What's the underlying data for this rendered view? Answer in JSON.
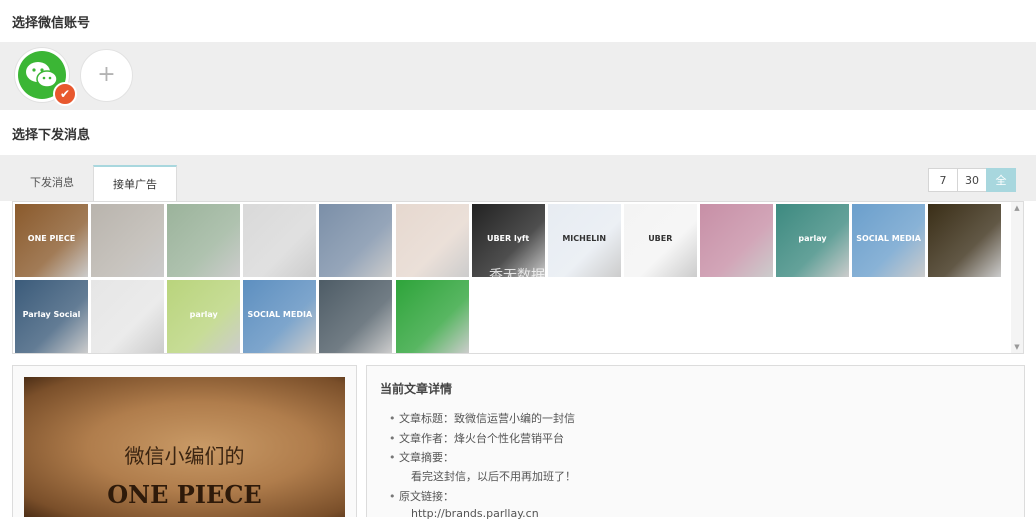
{
  "sections": {
    "account_title": "选择微信账号",
    "message_title": "选择下发消息"
  },
  "account": {
    "add_label": "+",
    "check_glyph": "✔",
    "wechat_icon": "wechat-icon"
  },
  "tabs": [
    {
      "label": "下发消息",
      "active": false
    },
    {
      "label": "接单广告",
      "active": true
    }
  ],
  "range_buttons": [
    {
      "label": "7",
      "active": false
    },
    {
      "label": "30",
      "active": false
    },
    {
      "label": "全",
      "active": true
    }
  ],
  "watermark": "香无数据",
  "thumbnails": [
    {
      "name": "thumb-one-piece",
      "color": "#8a5a2c",
      "text": "ONE PIECE"
    },
    {
      "name": "thumb-meeting-room",
      "color": "#b9b4ad",
      "text": ""
    },
    {
      "name": "thumb-speech-bubbles",
      "color": "#9bb39b",
      "text": ""
    },
    {
      "name": "thumb-smartphones",
      "color": "#d9d9d9",
      "text": ""
    },
    {
      "name": "thumb-businessmen",
      "color": "#7b8fa8",
      "text": ""
    },
    {
      "name": "thumb-hands",
      "color": "#e6d8cf",
      "text": ""
    },
    {
      "name": "thumb-uber-lyft",
      "color": "#222222",
      "text": "UBER lyft"
    },
    {
      "name": "thumb-michelin",
      "color": "#e7ecf2",
      "text": "MICHELIN"
    },
    {
      "name": "thumb-uber-logo",
      "color": "#f4f4f4",
      "text": "UBER"
    },
    {
      "name": "thumb-weibo-monsters",
      "color": "#c78fa6",
      "text": ""
    },
    {
      "name": "thumb-world-map",
      "color": "#3d8a80",
      "text": "parlay"
    },
    {
      "name": "thumb-social-media-globe",
      "color": "#6b9fcc",
      "text": "SOCIAL MEDIA"
    },
    {
      "name": "thumb-city-lights",
      "color": "#3a2e17",
      "text": ""
    },
    {
      "name": "thumb-parlay-site",
      "color": "#3b5b7a",
      "text": "Parlay Social"
    },
    {
      "name": "thumb-red-figure",
      "color": "#e6e6e6",
      "text": ""
    },
    {
      "name": "thumb-parlay-girl",
      "color": "#b9d47c",
      "text": "parlay"
    },
    {
      "name": "thumb-social-media-people",
      "color": "#5d8fc0",
      "text": "SOCIAL MEDIA"
    },
    {
      "name": "thumb-car-man",
      "color": "#4e5c66",
      "text": ""
    },
    {
      "name": "thumb-wechat-logo",
      "color": "#2ea43a",
      "text": ""
    }
  ],
  "preview": {
    "cn_text": "微信小编们的",
    "en_text": "ONE PIECE"
  },
  "detail": {
    "heading": "当前文章详情",
    "title_label": "文章标题：致微信运营小编的一封信",
    "author_label": "文章作者：烽火台个性化营销平台",
    "summary_label": "文章摘要：",
    "summary_value": "看完这封信，以后不用再加班了！",
    "link_label": "原文链接：",
    "link_value": "http://brands.parllay.cn"
  },
  "colors": {
    "accent": "#a8d7de",
    "wechat_green": "#3bb635",
    "badge_orange": "#e8582e",
    "band_gray": "#eeeeee"
  }
}
